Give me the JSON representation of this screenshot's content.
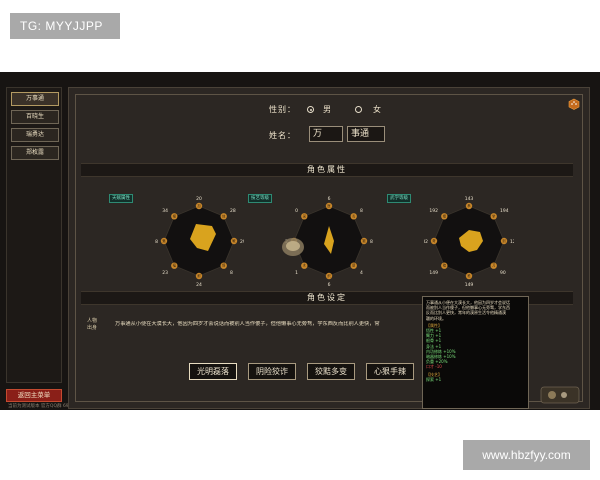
{
  "watermark_top": "TG: MYYJJPP",
  "watermark_bottom": "www.hbzfyy.com",
  "sidebar": {
    "items": [
      {
        "label": "万事通",
        "active": true
      },
      {
        "label": "百晓生",
        "active": false
      },
      {
        "label": "瑞勇达",
        "active": false
      },
      {
        "label": "郑枚露",
        "active": false
      }
    ],
    "return_label": "返回主菜单",
    "version": "当前为测试版本 官方QQ群 691906550"
  },
  "gender": {
    "label": "性别：",
    "male": "男",
    "female": "女",
    "selected": "male"
  },
  "name": {
    "label": "姓名：",
    "surname": "万",
    "given": "事通"
  },
  "attributes_title": "角色属性",
  "setting_title": "角色设定",
  "charts": [
    {
      "tag": "天赋属性",
      "labels": [
        "加",
        "体",
        "敏",
        "悟",
        "耐",
        "福",
        "魅",
        "根"
      ],
      "values": [
        "20",
        "28",
        "29",
        "8",
        "24",
        "23",
        "8",
        "34"
      ]
    },
    {
      "tag": "技艺等级",
      "labels": [
        "医",
        "毒",
        "锻",
        "厨",
        "织",
        "木",
        "药",
        "采"
      ],
      "values": [
        "6",
        "8",
        "8",
        "4",
        "6",
        "1",
        "2",
        "0"
      ]
    },
    {
      "tag": "武学等级",
      "labels": [
        "拳",
        "掌",
        "剑",
        "刀",
        "枪",
        "暗",
        "奇",
        "棍"
      ],
      "values": [
        "143",
        "194",
        "126",
        "90",
        "149",
        "149",
        "182",
        "192"
      ]
    }
  ],
  "bio": {
    "label_line1": "人物",
    "label_line2": "出身",
    "text": "万事通从小便在大漠长大，他因为四岁才会说话而被别人当作傻子，但他懒事心无旁骛，学东西反而比别人更快，常"
  },
  "traits": [
    {
      "label": "光明磊落",
      "active": true
    },
    {
      "label": "阴险狡诈",
      "active": false
    },
    {
      "label": "狡黠多变",
      "active": false
    },
    {
      "label": "心狠手辣",
      "active": false
    }
  ],
  "tooltip": {
    "intro": [
      "万事通从小便在大漠长大，他因为四岁才会说话",
      "而被别人当作傻子，但他懒事心无旁骛，学东西",
      "反而比别人更快，常年的漠原生活令他精通漠",
      "疆的环境。"
    ],
    "sec1": "【属性】",
    "stats": [
      "悟性 +1",
      "臂力 +1",
      "根骨 +1",
      "身法 +1",
      "内功修炼 +10%",
      "暗器修炼 +10%",
      "负重 +20%",
      "口才 -10"
    ],
    "sec2": "【技艺】",
    "skills": [
      "探索 +1"
    ]
  }
}
